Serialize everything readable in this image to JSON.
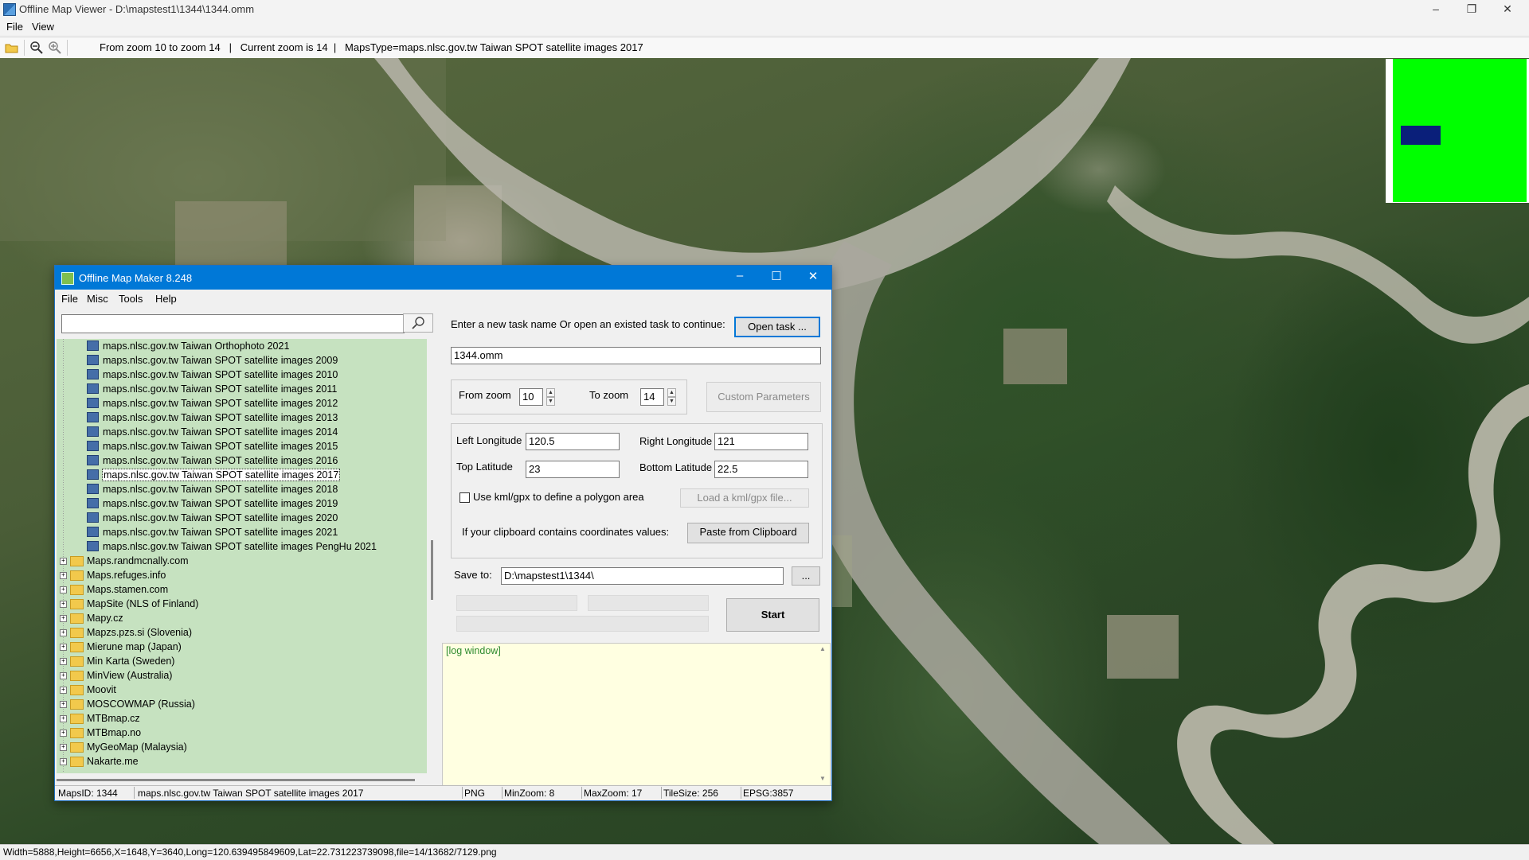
{
  "viewer": {
    "title": "Offline Map Viewer - D:\\mapstest1\\1344\\1344.omm",
    "menu": [
      "File",
      "View"
    ],
    "toolbar_status": "From zoom 10 to zoom 14   |   Current zoom is 14  |   MapsType=maps.nlsc.gov.tw Taiwan SPOT satellite images 2017",
    "status_bar": "Width=5888,Height=6656,X=1648,Y=3640,Long=120.639495849609,Lat=22.731223739098,file=14/13682/7129.png",
    "window_controls": {
      "minimize": "–",
      "maximize": "❐",
      "close": "✕"
    }
  },
  "dialog": {
    "title": "Offline Map Maker 8.248",
    "menu": [
      "File",
      "Misc",
      "Tools",
      "Help"
    ],
    "window_controls": {
      "minimize": "–",
      "maximize": "☐",
      "close": "✕"
    },
    "search": {
      "value": "",
      "placeholder": ""
    },
    "tree_items": [
      {
        "label": "maps.nlsc.gov.tw Taiwan Orthophoto 2021",
        "type": "map"
      },
      {
        "label": "maps.nlsc.gov.tw Taiwan SPOT satellite images 2009",
        "type": "map"
      },
      {
        "label": "maps.nlsc.gov.tw Taiwan SPOT satellite images 2010",
        "type": "map"
      },
      {
        "label": "maps.nlsc.gov.tw Taiwan SPOT satellite images 2011",
        "type": "map"
      },
      {
        "label": "maps.nlsc.gov.tw Taiwan SPOT satellite images 2012",
        "type": "map"
      },
      {
        "label": "maps.nlsc.gov.tw Taiwan SPOT satellite images 2013",
        "type": "map"
      },
      {
        "label": "maps.nlsc.gov.tw Taiwan SPOT satellite images 2014",
        "type": "map"
      },
      {
        "label": "maps.nlsc.gov.tw Taiwan SPOT satellite images 2015",
        "type": "map"
      },
      {
        "label": "maps.nlsc.gov.tw Taiwan SPOT satellite images 2016",
        "type": "map"
      },
      {
        "label": "maps.nlsc.gov.tw Taiwan SPOT satellite images 2017",
        "type": "map",
        "selected": true
      },
      {
        "label": "maps.nlsc.gov.tw Taiwan SPOT satellite images 2018",
        "type": "map"
      },
      {
        "label": "maps.nlsc.gov.tw Taiwan SPOT satellite images 2019",
        "type": "map"
      },
      {
        "label": "maps.nlsc.gov.tw Taiwan SPOT satellite images 2020",
        "type": "map"
      },
      {
        "label": "maps.nlsc.gov.tw Taiwan SPOT satellite images 2021",
        "type": "map"
      },
      {
        "label": "maps.nlsc.gov.tw Taiwan SPOT satellite images PengHu 2021",
        "type": "map"
      },
      {
        "label": "Maps.randmcnally.com",
        "type": "folder"
      },
      {
        "label": "Maps.refuges.info",
        "type": "folder"
      },
      {
        "label": "Maps.stamen.com",
        "type": "folder"
      },
      {
        "label": "MapSite (NLS of Finland)",
        "type": "folder"
      },
      {
        "label": "Mapy.cz",
        "type": "folder"
      },
      {
        "label": "Mapzs.pzs.si (Slovenia)",
        "type": "folder"
      },
      {
        "label": "Mierune map (Japan)",
        "type": "folder"
      },
      {
        "label": "Min Karta (Sweden)",
        "type": "folder"
      },
      {
        "label": "MinView (Australia)",
        "type": "folder"
      },
      {
        "label": "Moovit",
        "type": "folder"
      },
      {
        "label": "MOSCOWMAP (Russia)",
        "type": "folder"
      },
      {
        "label": "MTBmap.cz",
        "type": "folder"
      },
      {
        "label": "MTBmap.no",
        "type": "folder"
      },
      {
        "label": "MyGeoMap (Malaysia)",
        "type": "folder"
      },
      {
        "label": "Nakarte.me",
        "type": "folder"
      }
    ],
    "task_prompt": "Enter a new task name Or open an existed task to continue:",
    "open_task_label": "Open task ...",
    "task_name": "1344.omm",
    "from_zoom_label": "From zoom",
    "from_zoom": "10",
    "to_zoom_label": "To zoom",
    "to_zoom": "14",
    "custom_params_label": "Custom Parameters",
    "left_long_label": "Left Longitude",
    "left_long": "120.5",
    "right_long_label": "Right Longitude",
    "right_long": "121",
    "top_lat_label": "Top Latitude",
    "top_lat": "23",
    "bottom_lat_label": "Bottom Latitude",
    "bottom_lat": "22.5",
    "kml_checkbox_label": "Use kml/gpx to define a polygon area",
    "kml_checked": false,
    "load_kml_label": "Load a kml/gpx file...",
    "clipboard_prompt": "If your clipboard contains coordinates values:",
    "paste_label": "Paste from Clipboard",
    "save_to_label": "Save to:",
    "save_path": "D:\\mapstest1\\1344\\",
    "browse_label": "...",
    "start_label": "Start",
    "log_text": "[log window]",
    "status": {
      "maps_id": "MapsID: 1344",
      "map_name": "maps.nlsc.gov.tw Taiwan SPOT satellite images 2017",
      "format": "PNG",
      "min_zoom": "MinZoom: 8",
      "max_zoom": "MaxZoom: 17",
      "tile_size": "TileSize: 256",
      "epsg": "EPSG:3857"
    }
  },
  "colors": {
    "dialog_titlebar": "#0078d7",
    "tree_background": "#c6e2c0",
    "log_background": "#ffffe1",
    "minimap_green": "#00ff00",
    "minimap_viewport": "#0a1f7a"
  }
}
